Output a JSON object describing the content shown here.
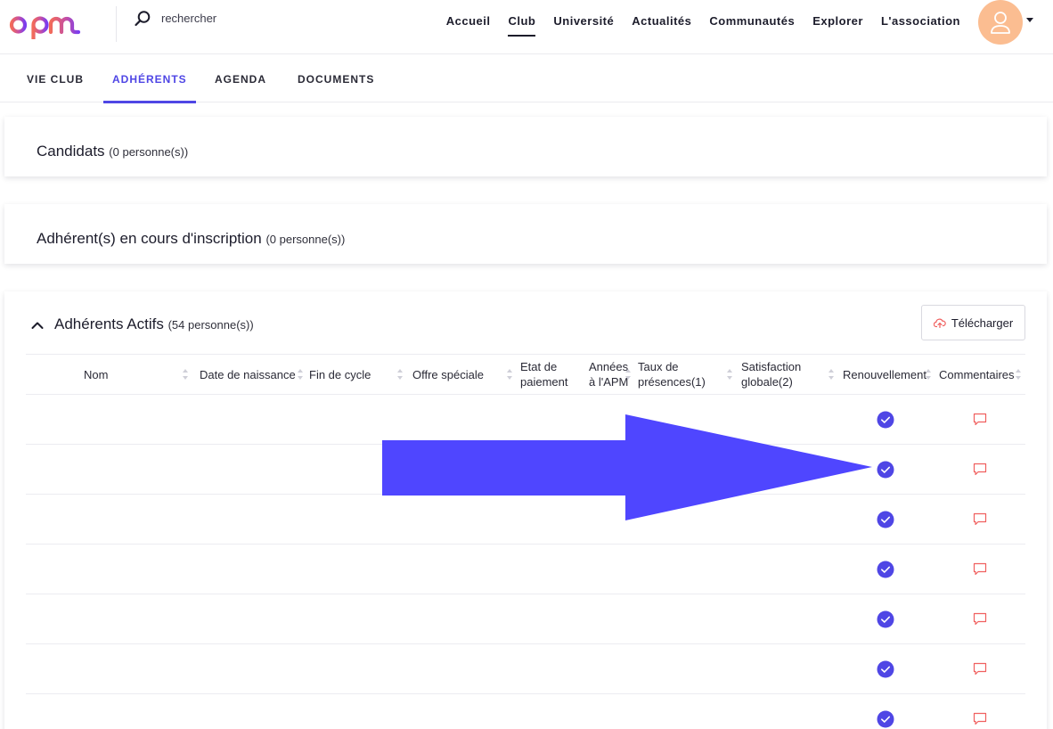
{
  "header": {
    "logo_text": "apm",
    "search": {
      "placeholder": "rechercher"
    },
    "nav": [
      {
        "label": "Accueil",
        "active": false
      },
      {
        "label": "Club",
        "active": true
      },
      {
        "label": "Université",
        "active": false
      },
      {
        "label": "Actualités",
        "active": false
      },
      {
        "label": "Communautés",
        "active": false
      },
      {
        "label": "Explorer",
        "active": false
      },
      {
        "label": "L'association",
        "active": false
      }
    ]
  },
  "subtabs": [
    {
      "label": "VIE CLUB",
      "active": false
    },
    {
      "label": "ADHÉRENTS",
      "active": true
    },
    {
      "label": "AGENDA",
      "active": false
    },
    {
      "label": "DOCUMENTS",
      "active": false
    }
  ],
  "sections": {
    "candidats": {
      "title": "Candidats",
      "count": "(0 personne(s))"
    },
    "inscription": {
      "title": "Adhérent(s) en cours d'inscription",
      "count": "(0 personne(s))"
    },
    "actifs": {
      "title": "Adhérents Actifs",
      "count": "(54 personne(s))",
      "download_label": "Télécharger"
    }
  },
  "table": {
    "columns": [
      {
        "line1": "Nom",
        "line2": ""
      },
      {
        "line1": "Date de naissance",
        "line2": ""
      },
      {
        "line1": "Fin de cycle",
        "line2": ""
      },
      {
        "line1": "Offre spéciale",
        "line2": ""
      },
      {
        "line1": "Etat de",
        "line2": "paiement"
      },
      {
        "line1": "Années",
        "line2": "à l'APM"
      },
      {
        "line1": "Taux de",
        "line2": "présences(1)"
      },
      {
        "line1": "Satisfaction",
        "line2": "globale(2)"
      },
      {
        "line1": "Renouvellement",
        "line2": ""
      },
      {
        "line1": "Commentaires",
        "line2": ""
      }
    ],
    "visible_rows": 7,
    "renewal_checked": true
  },
  "colors": {
    "accent": "#4f46e5",
    "arrow": "#4f46ff",
    "avatar": "#fbbd91",
    "comment_icon": "#f0605f",
    "logo_gradient": [
      "#f26b5b",
      "#7a3df0"
    ]
  },
  "icons": {
    "search": "search-icon",
    "avatar": "user-icon",
    "collapse": "chevron-up-icon",
    "download": "cloud-upload-icon",
    "sort": "sort-icon",
    "renewal": "check-circle-icon",
    "comment": "comment-icon"
  }
}
